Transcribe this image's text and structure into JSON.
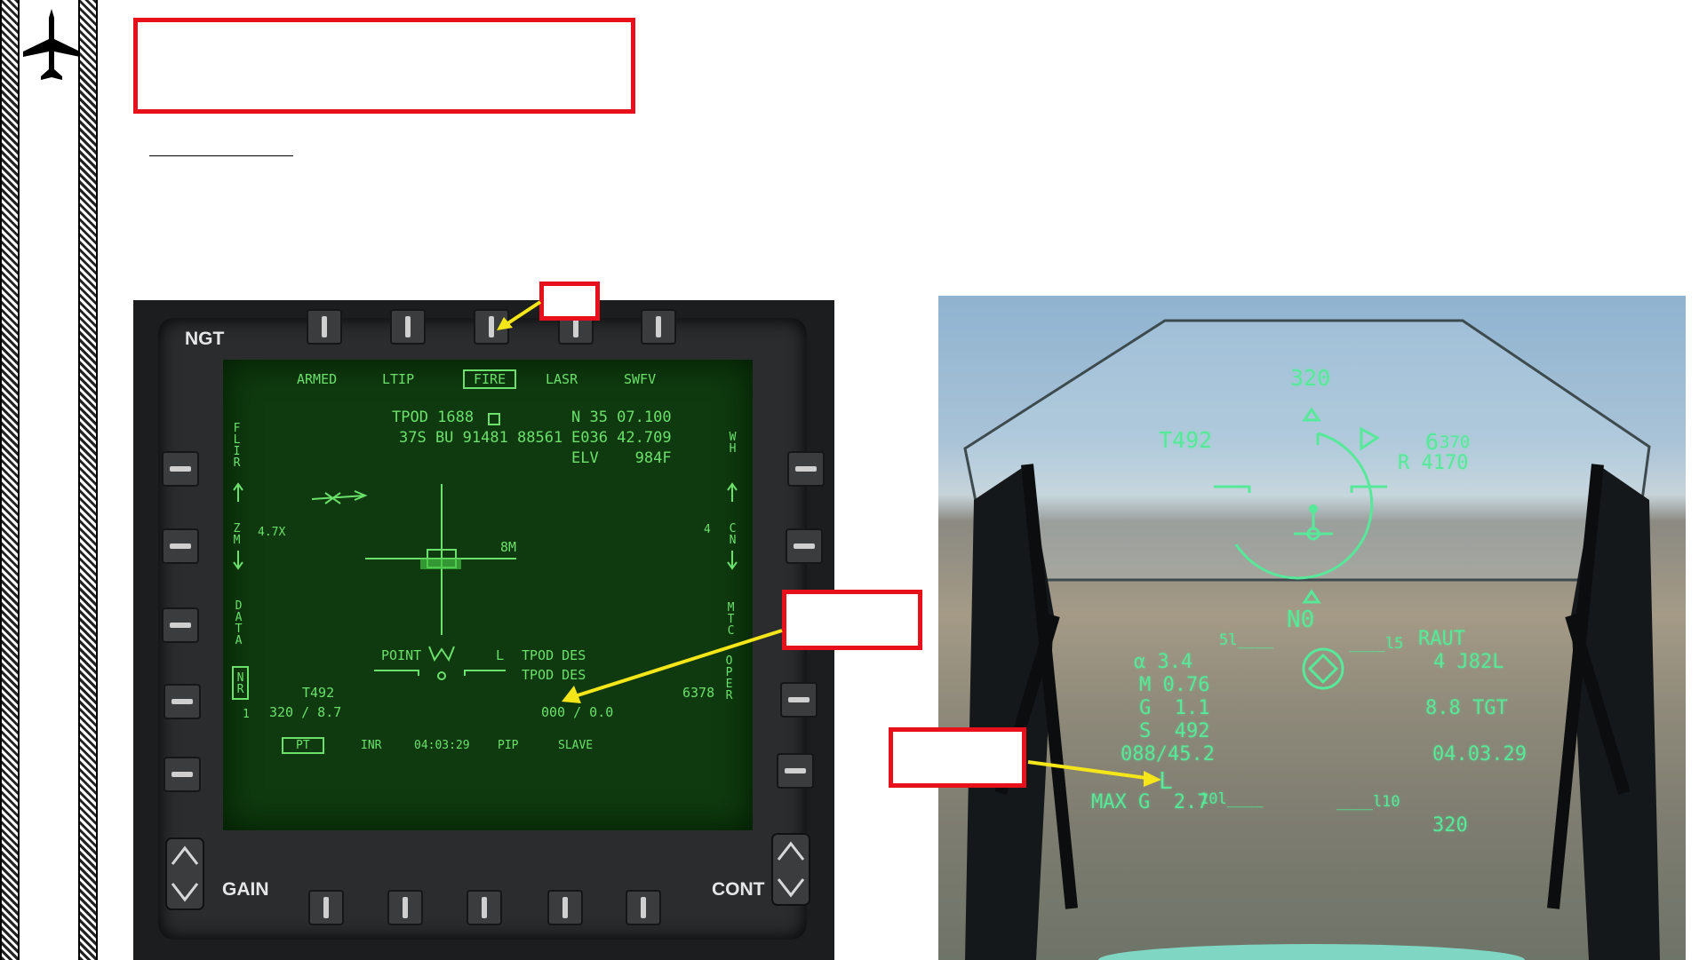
{
  "mfd": {
    "top_menu": [
      "ARMED",
      "LTIP",
      "FIRE",
      "LASR",
      "SWFV"
    ],
    "header_left": "NGT",
    "pod_line1": "TPOD 1688",
    "pod_line2": "37S BU 91481 88561",
    "coord_n": "N 35 07.100",
    "coord_e": "E036 42.709",
    "elev": "ELV    984F",
    "left_side": {
      "flir": "FLIR",
      "zm": "ZM",
      "zoom": "4.7X",
      "data": "DATA",
      "nr": "NR",
      "one": "1"
    },
    "right_side": {
      "wh": "WH",
      "cn": "CN",
      "four": "4",
      "mtc": "MTC",
      "oper": "OPER"
    },
    "range_mark": "8M",
    "point": "POINT",
    "laser_cue": "L",
    "tpod_des1": "TPOD DES",
    "tpod_des2": "TPOD DES",
    "target_id": "T492",
    "brg_rng": "320 / 8.7",
    "alt_num": "6378",
    "zero_rng": "000 / 0.0",
    "bottom_menu": [
      "PT",
      "INR",
      "04:03:29",
      "PIP",
      "SLAVE"
    ],
    "gain": "GAIN",
    "cont": "CONT"
  },
  "hud": {
    "heading": "320",
    "target": "T492",
    "alt_big": "6",
    "alt_small": "370",
    "radar": "R 4170",
    "no_text": "N0",
    "ladder_left": "5l____",
    "ladder_right": "____l5",
    "raut": "RAUT",
    "j82l": "4 J82L",
    "alpha": "α 3.4",
    "mach": "M 0.76",
    "g": "G  1.1",
    "s": "S  492",
    "brg": "088/45.2",
    "tgt": "8.8 TGT",
    "time": "04.03.29",
    "laser": "L",
    "maxg": "MAX G  2.7",
    "ladder_bl": "10l____",
    "ladder_br": "____l10",
    "bottom_hdg": "320"
  }
}
